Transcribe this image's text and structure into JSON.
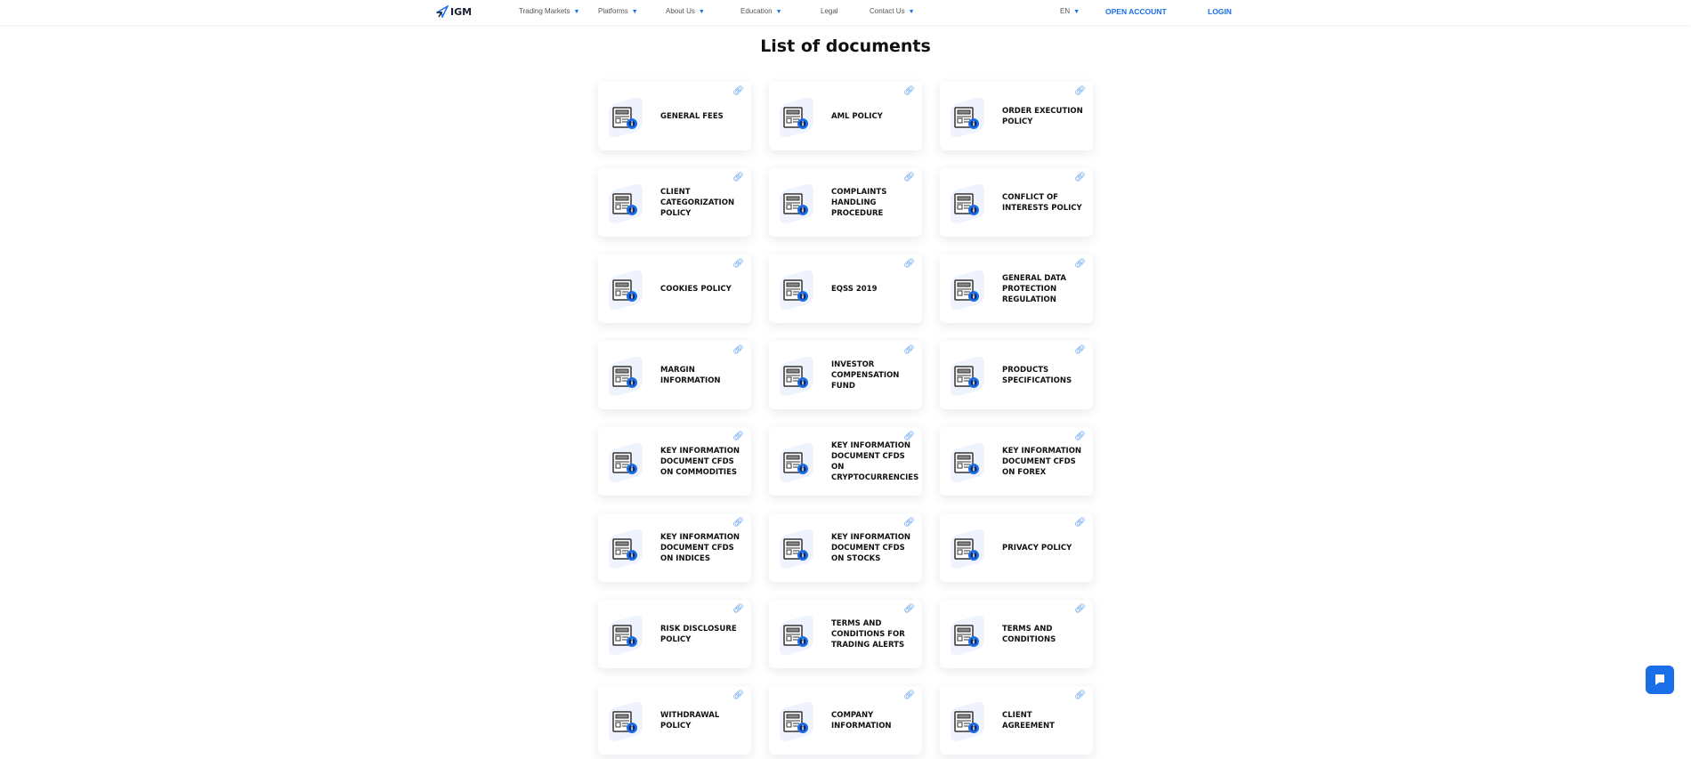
{
  "nav": {
    "logo": "IGM",
    "items": [
      "Trading Markets",
      "Platforms",
      "About Us",
      "Education",
      "Legal",
      "Contact Us"
    ],
    "has_caret": [
      true,
      true,
      true,
      true,
      false,
      true
    ],
    "lang": "EN",
    "open_account": "OPEN ACCOUNT",
    "login": "LOGIN"
  },
  "page_title": "List of documents",
  "documents": [
    "General fees",
    "AML Policy",
    "Order Execution Policy",
    "Client Categorization Policy",
    "Complaints Handling Procedure",
    "Conflict of Interests Policy",
    "Cookies Policy",
    "EQSS 2019",
    "General Data Protection Regulation",
    "Margin Information",
    "Investor Compensation Fund",
    "Products Specifications",
    "Key Information Document CFDs on Commodities",
    "Key Information Document CFDs on Cryptocurrencies",
    "Key Information Document CFDs on Forex",
    "Key Information Document CFDs on Indices",
    "Key Information Document CFDs on Stocks",
    "Privacy Policy",
    "Risk Disclosure Policy",
    "Terms and Conditions for Trading Alerts",
    "Terms and Conditions",
    "Withdrawal Policy",
    "Company Information",
    "Client Agreement"
  ],
  "colors": {
    "accent": "#1a6fe8"
  }
}
